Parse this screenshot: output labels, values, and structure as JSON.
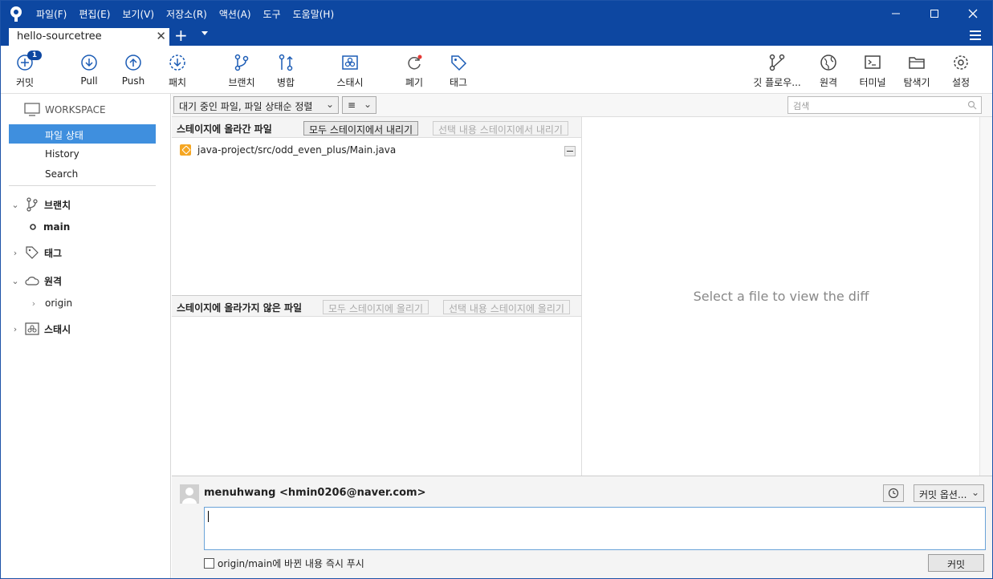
{
  "menu": [
    "파일(F)",
    "편집(E)",
    "보기(V)",
    "저장소(R)",
    "액션(A)",
    "도구",
    "도움말(H)"
  ],
  "tab": {
    "title": "hello-sourcetree"
  },
  "toolbar": {
    "commit": "커밋",
    "commit_badge": "1",
    "pull": "Pull",
    "push": "Push",
    "patch": "패치",
    "branch": "브랜치",
    "merge": "병합",
    "stash": "스태시",
    "discard": "폐기",
    "tag": "태그",
    "gitflow": "깃 플로우...",
    "remote": "원격",
    "terminal": "터미널",
    "explorer": "탐색기",
    "settings": "설정"
  },
  "sidebar": {
    "workspace": "WORKSPACE",
    "items": [
      "파일 상태",
      "History",
      "Search"
    ],
    "branches": "브랜치",
    "branch_main": "main",
    "tags": "태그",
    "remotes": "원격",
    "remote_origin": "origin",
    "stashes": "스태시"
  },
  "filter": {
    "sort": "대기 중인 파일, 파일 상태순 정렬",
    "view": "≡",
    "search_placeholder": "검색"
  },
  "staged": {
    "title": "스테이지에 올라간 파일",
    "unstage_all": "모두 스테이지에서 내리기",
    "unstage_sel": "선택 내용 스테이지에서 내리기",
    "files": [
      "java-project/src/odd_even_plus/Main.java"
    ]
  },
  "unstaged": {
    "title": "스테이지에 올라가지 않은 파일",
    "stage_all": "모두 스테이지에 올리기",
    "stage_sel": "선택 내용 스테이지에 올리기"
  },
  "diff": {
    "placeholder": "Select a file to view the diff"
  },
  "commit": {
    "author": "menuhwang <hmin0206@naver.com>",
    "options": "커밋 옵션...",
    "push_label": "origin/main에 바뀐 내용 즉시 푸시",
    "button": "커밋"
  },
  "colors": {
    "accent": "#0d47a1",
    "selection": "#3f8fde",
    "warn": "#f5a623"
  }
}
